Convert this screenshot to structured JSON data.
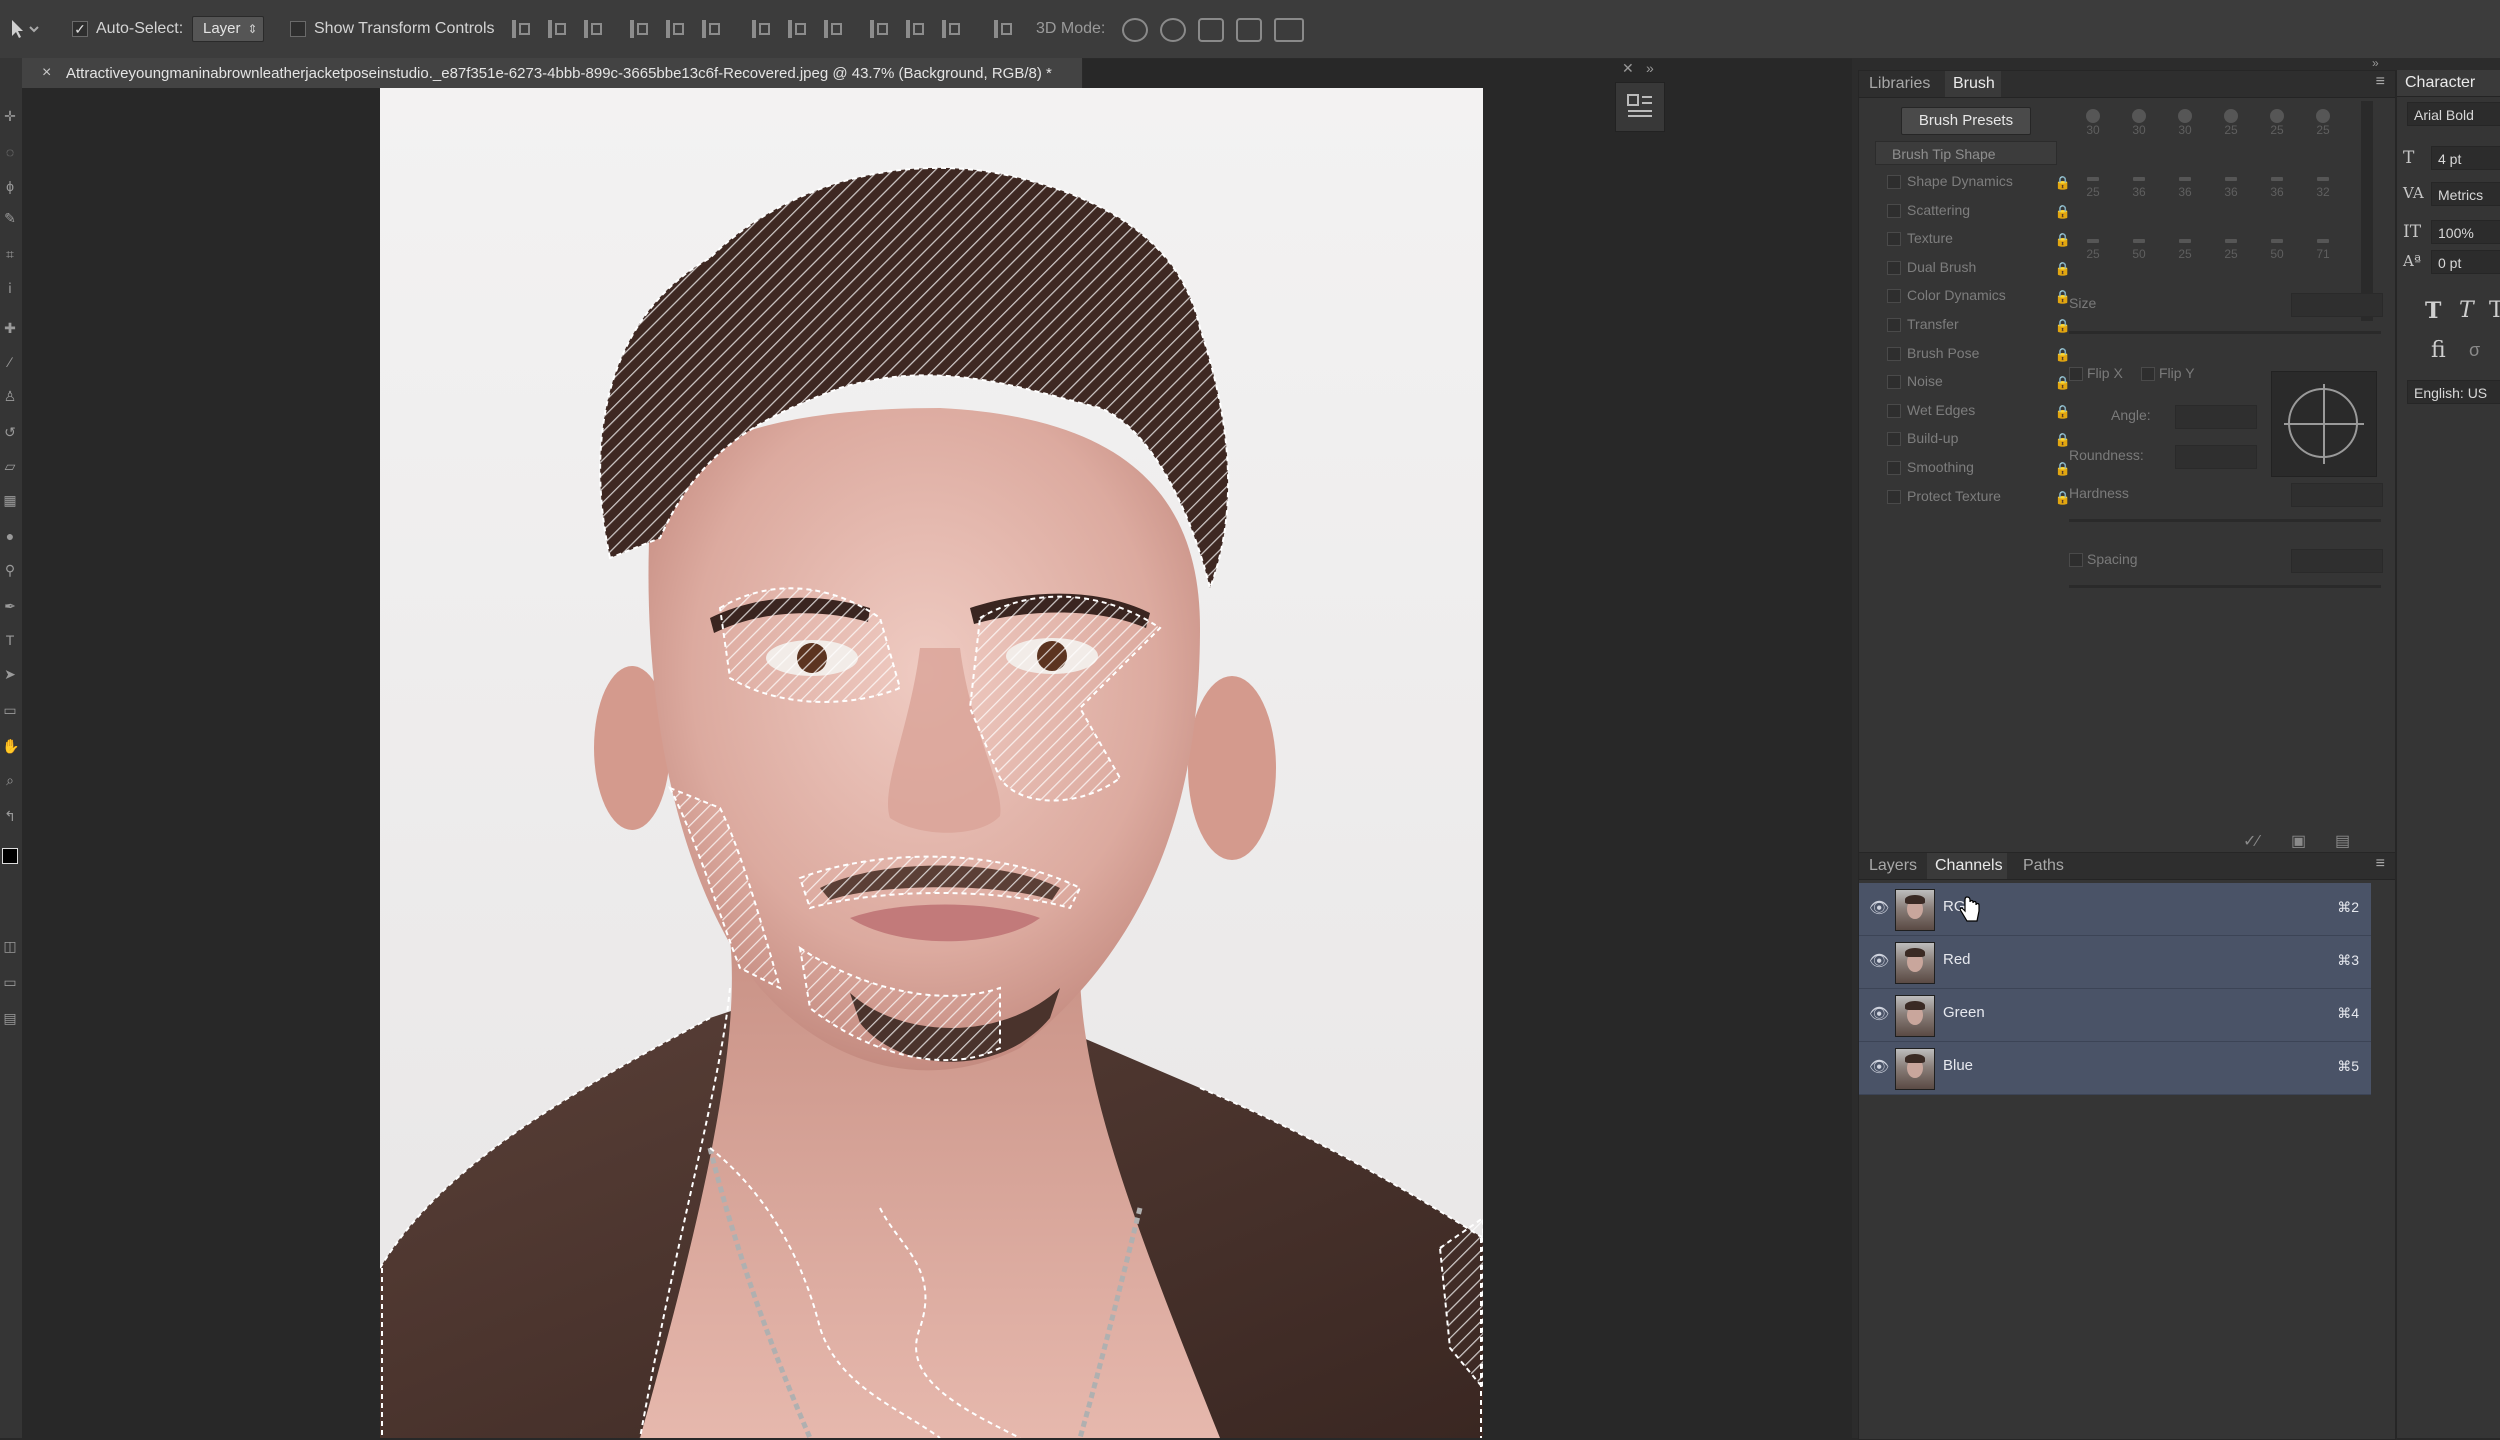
{
  "options_bar": {
    "auto_select_label": "Auto-Select:",
    "auto_select_checked": "✓",
    "auto_select_target": "Layer",
    "show_transform_label": "Show Transform Controls",
    "mode_3d_label": "3D Mode:"
  },
  "document": {
    "tab_title": "Attractiveyoungmaninabrownleatherjacketposeinstudio._e87f351e-6273-4bbb-899c-3665bbe13c6f-Recovered.jpeg @ 43.7% (Background, RGB/8) *",
    "close_icon": "×"
  },
  "brush_panel": {
    "tabs": [
      "Libraries",
      "Brush"
    ],
    "active_tab": "Brush",
    "presets_button": "Brush Presets",
    "tip_shape": "Brush Tip Shape",
    "options": [
      "Shape Dynamics",
      "Scattering",
      "Texture",
      "Dual Brush",
      "Color Dynamics",
      "Transfer",
      "Brush Pose",
      "Noise",
      "Wet Edges",
      "Build-up",
      "Smoothing",
      "Protect Texture"
    ],
    "preset_sizes": [
      [
        "30",
        "30",
        "30",
        "25",
        "25",
        "25"
      ],
      [
        "25",
        "36",
        "36",
        "36",
        "36",
        "32"
      ],
      [
        "25",
        "50",
        "25",
        "25",
        "50",
        "71"
      ]
    ],
    "size_label": "Size",
    "flip_x": "Flip X",
    "flip_y": "Flip Y",
    "angle_label": "Angle:",
    "roundness_label": "Roundness:",
    "hardness_label": "Hardness",
    "spacing_label": "Spacing"
  },
  "channels_panel": {
    "tabs": [
      "Layers",
      "Channels",
      "Paths"
    ],
    "active_tab": "Channels",
    "rows": [
      {
        "name": "RGB",
        "shortcut": "⌘2"
      },
      {
        "name": "Red",
        "shortcut": "⌘3"
      },
      {
        "name": "Green",
        "shortcut": "⌘4"
      },
      {
        "name": "Blue",
        "shortcut": "⌘5"
      }
    ]
  },
  "character_panel": {
    "tab": "Character",
    "font": "Arial Bold",
    "size": "4 pt",
    "kerning": "Metrics",
    "vertical_scale": "100%",
    "baseline_shift": "0 pt",
    "language": "English: US",
    "ligature_glyph": "fi"
  },
  "colors": {
    "selected_row": "#4a5367",
    "panel_bg": "#353535",
    "canvas_bg": "#282828"
  }
}
